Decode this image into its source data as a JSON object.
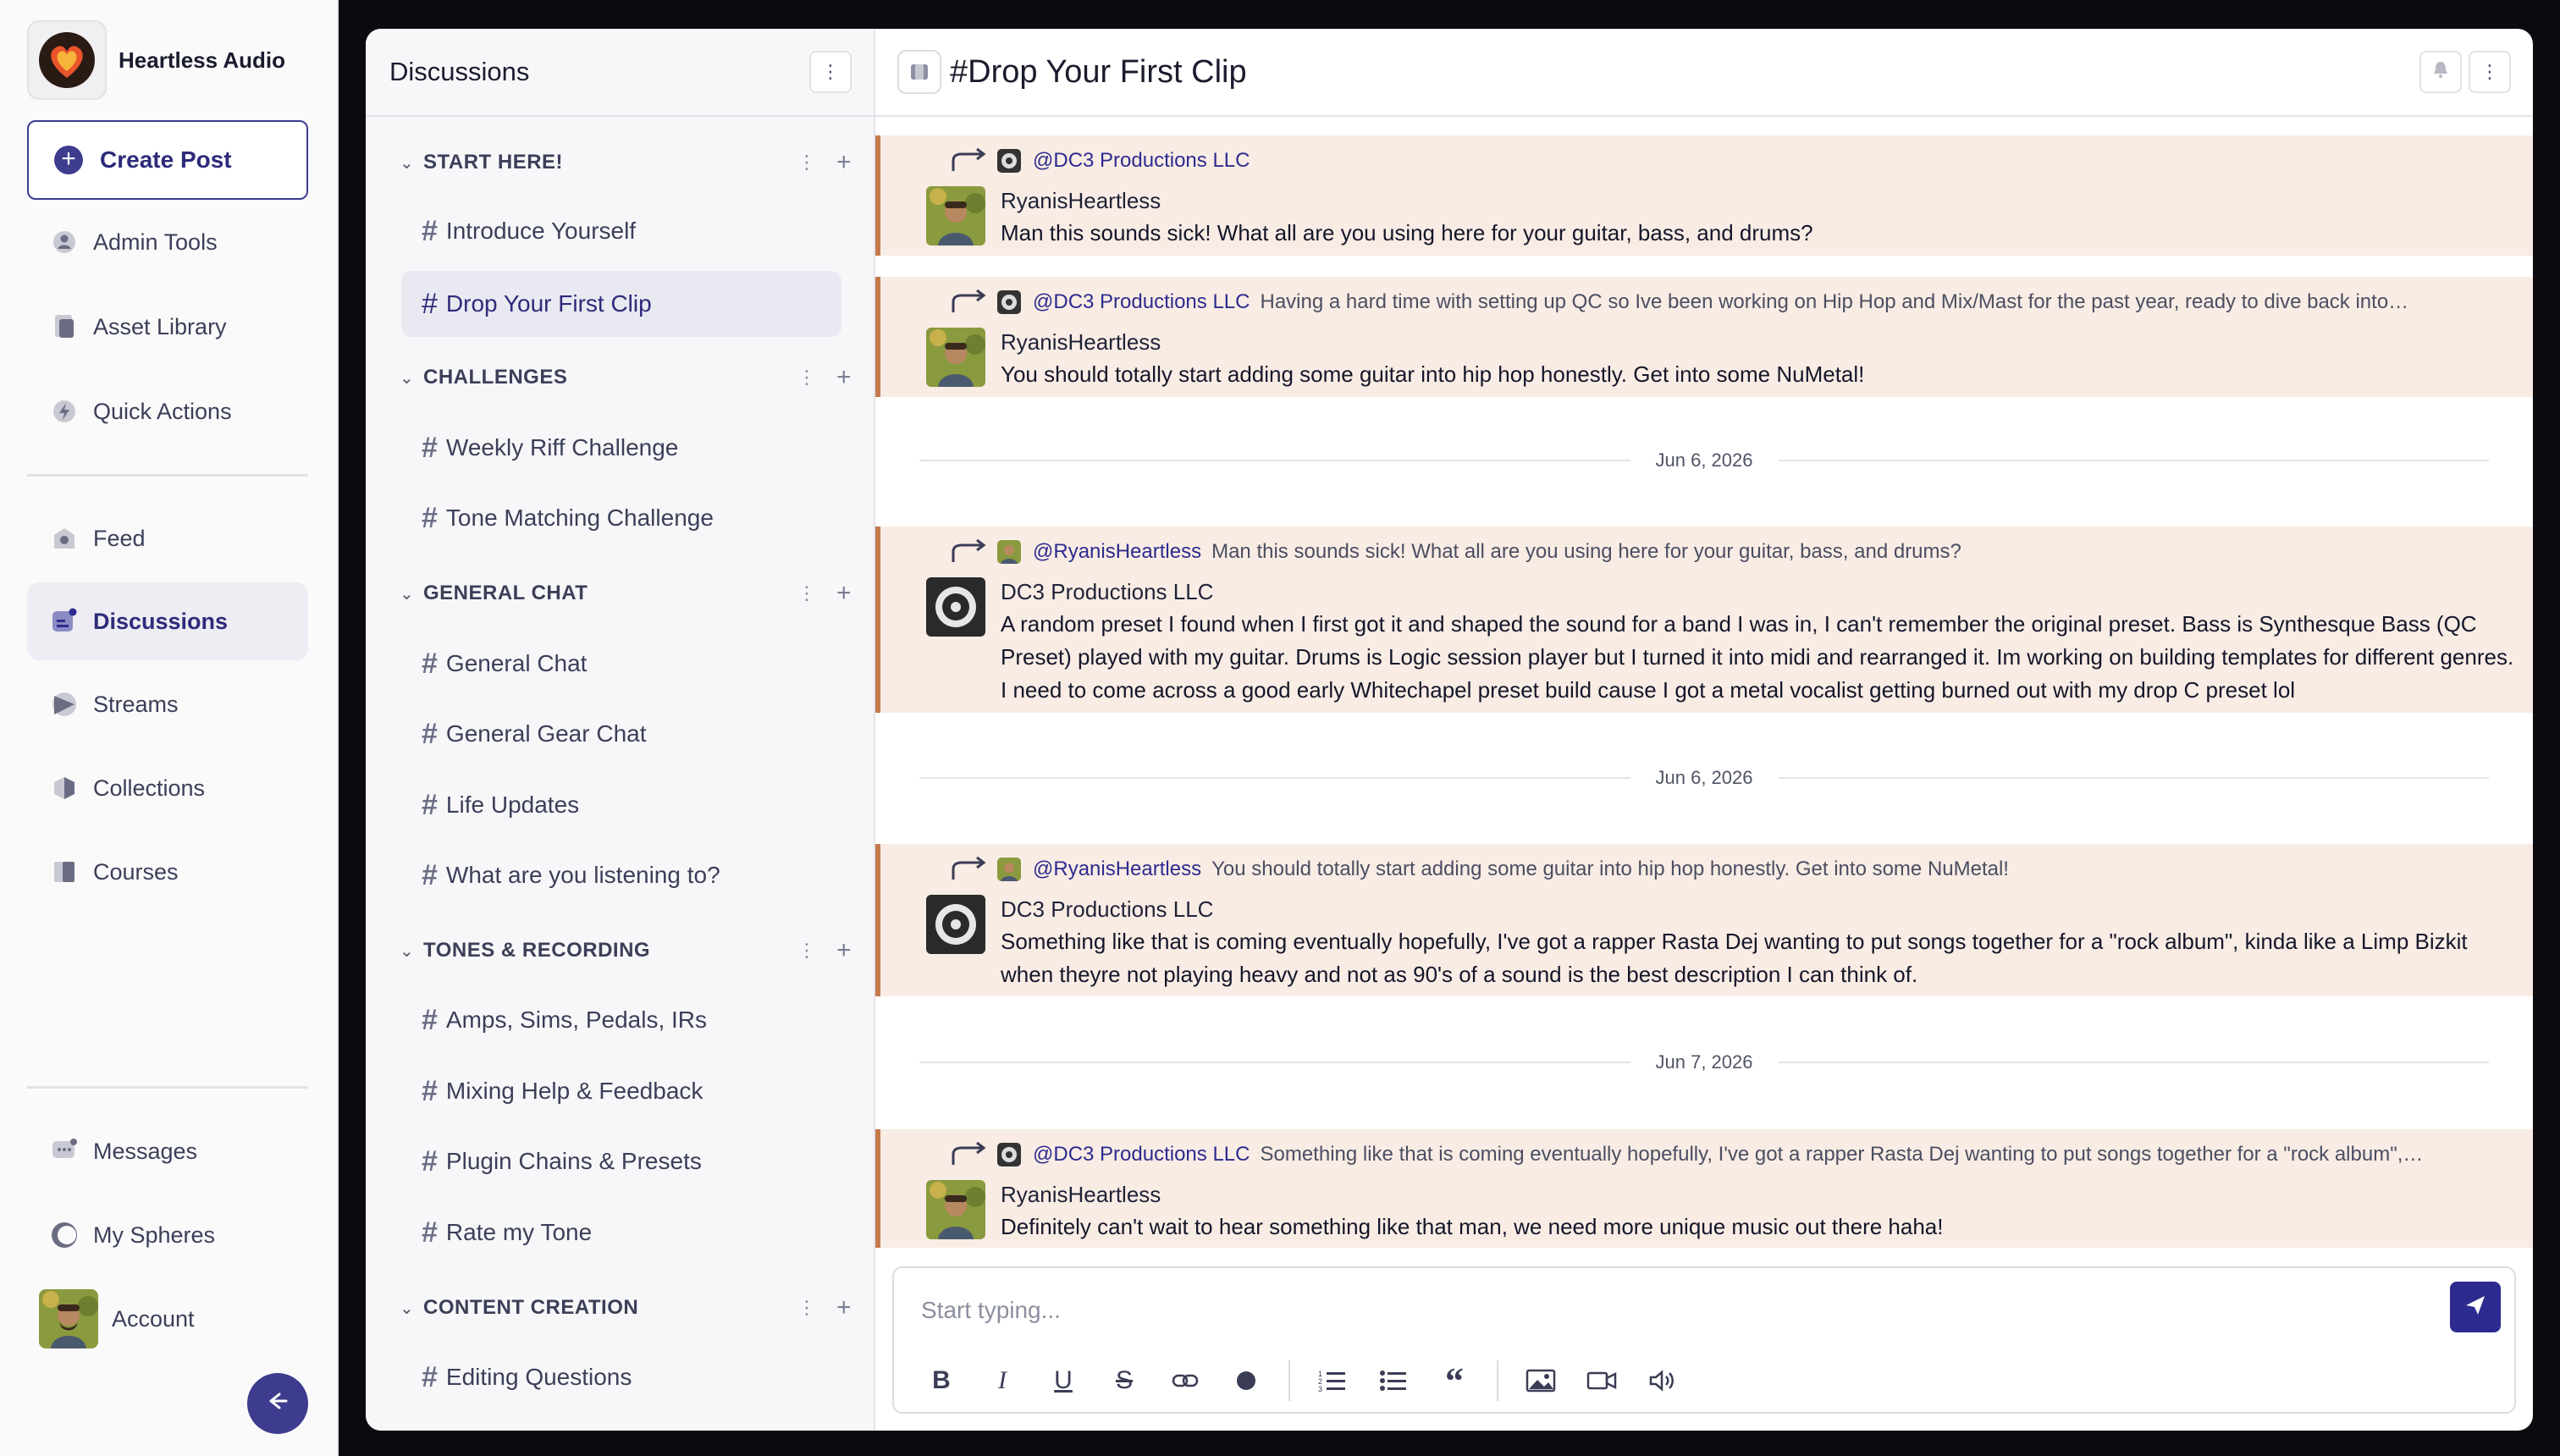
{
  "brand": {
    "name": "Heartless Audio"
  },
  "sidebar": {
    "create_post": "Create Post",
    "nav_top": [
      {
        "label": "Admin Tools",
        "icon": "user-badge-icon"
      },
      {
        "label": "Asset Library",
        "icon": "document-icon"
      },
      {
        "label": "Quick Actions",
        "icon": "lightning-icon"
      }
    ],
    "nav_main": [
      {
        "label": "Feed",
        "icon": "feed-icon"
      },
      {
        "label": "Discussions",
        "icon": "discussions-icon",
        "active": true
      },
      {
        "label": "Streams",
        "icon": "play-icon"
      },
      {
        "label": "Collections",
        "icon": "cube-icon"
      },
      {
        "label": "Courses",
        "icon": "book-icon"
      }
    ],
    "nav_bottom": [
      {
        "label": "Messages",
        "icon": "chat-bubble-icon"
      },
      {
        "label": "My Spheres",
        "icon": "sphere-icon"
      },
      {
        "label": "Account",
        "icon": "avatar"
      }
    ]
  },
  "channels": {
    "title": "Discussions",
    "categories": [
      {
        "label": "START HERE!",
        "items": [
          "Introduce Yourself",
          "Drop Your First Clip"
        ]
      },
      {
        "label": "CHALLENGES",
        "items": [
          "Weekly Riff Challenge",
          "Tone Matching Challenge"
        ]
      },
      {
        "label": "GENERAL CHAT",
        "items": [
          "General Chat",
          "General Gear Chat",
          "Life Updates",
          "What are you listening to?"
        ]
      },
      {
        "label": "TONES & RECORDING",
        "items": [
          "Amps, Sims, Pedals, IRs",
          "Mixing Help & Feedback",
          "Plugin Chains & Presets",
          "Rate my Tone"
        ]
      },
      {
        "label": "CONTENT CREATION",
        "items": [
          "Editing Questions"
        ]
      }
    ],
    "active": "Drop Your First Clip"
  },
  "conversation": {
    "title": "#Drop Your First Clip",
    "messages": [
      {
        "reply_to": "@DC3 Productions LLC",
        "reply_text": "",
        "reply_avatar": "dc3",
        "author": "RyanisHeartless",
        "author_avatar": "ryan",
        "body": "Man this sounds sick! What all are you using here for your guitar, bass, and drums?"
      },
      {
        "reply_to": "@DC3 Productions LLC",
        "reply_text": "Having a hard time with setting up QC so Ive been working on Hip Hop and Mix/Mast for the past year, ready to dive back into…",
        "reply_avatar": "dc3",
        "author": "RyanisHeartless",
        "author_avatar": "ryan",
        "body": "You should totally start adding some guitar into hip hop honestly. Get into some NuMetal!"
      },
      {
        "reply_to": "@RyanisHeartless",
        "reply_text": "Man this sounds sick! What all are you using here for your guitar, bass, and drums?",
        "reply_avatar": "ryan",
        "author": "DC3 Productions LLC",
        "author_avatar": "dc3",
        "body": "A random preset I found when I first got it and shaped the sound for a band I was in, I can't remember the original preset. Bass is Synthesque Bass (QC Preset) played with my guitar.  Drums is Logic session player but I turned it into midi and rearranged it. Im working on building templates for different genres. I need to come across a good early Whitechapel preset build cause I got a metal vocalist getting burned out with my drop C preset lol"
      },
      {
        "reply_to": "@RyanisHeartless",
        "reply_text": "You should totally start adding some guitar into hip hop honestly. Get into some NuMetal!",
        "reply_avatar": "ryan",
        "author": "DC3 Productions LLC",
        "author_avatar": "dc3",
        "body": "Something like that is coming eventually hopefully, I've got a rapper Rasta Dej wanting to put songs together for a \"rock album\", kinda like a Limp Bizkit when theyre not playing heavy and not as 90's of a sound is the best description I can think of."
      },
      {
        "reply_to": "@DC3 Productions LLC",
        "reply_text": "Something like that is coming eventually hopefully, I've got a rapper Rasta Dej wanting to put songs together for a \"rock album\",…",
        "reply_avatar": "dc3",
        "author": "RyanisHeartless",
        "author_avatar": "ryan",
        "body": "Definitely can't wait to hear something like that man, we need more unique music out there haha!"
      }
    ],
    "dates": [
      "Jun 6, 2026",
      "Jun 6, 2026",
      "Jun 7, 2026"
    ]
  },
  "composer": {
    "placeholder": "Start typing...",
    "tools": [
      "bold-icon",
      "italic-icon",
      "underline-icon",
      "strikethrough-icon",
      "link-icon",
      "emoji-icon",
      "ordered-list-icon",
      "bullet-list-icon",
      "quote-icon",
      "image-icon",
      "video-icon",
      "audio-icon"
    ]
  },
  "colors": {
    "accent": "#2d2b8f",
    "message_bg": "#f8ece4",
    "message_border": "#c47a4c"
  }
}
